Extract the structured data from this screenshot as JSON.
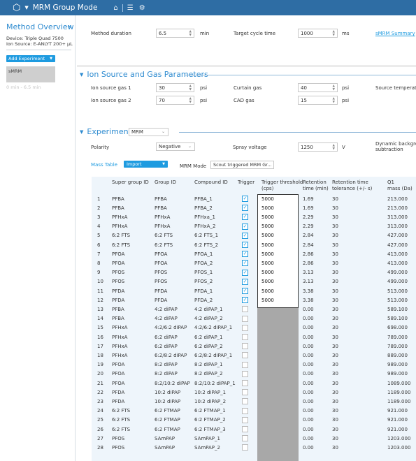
{
  "app": {
    "title": "MRM Group Mode"
  },
  "sidebar": {
    "title": "Method Overview",
    "collapse_glyph": "«",
    "device": "Device: Triple Quad 7500",
    "ion_source": "Ion Source: E-ANLYT 200+ µL",
    "add_experiment": "Add Experiment",
    "experiment_item": "sMRM",
    "time_range": "0 min - 6.5 min"
  },
  "method": {
    "duration_label": "Method duration",
    "duration_value": "6.5",
    "duration_unit": "min",
    "cycle_label": "Target cycle time",
    "cycle_value": "1000",
    "cycle_unit": "ms",
    "summary_link": "sMRM Summary"
  },
  "source_gas": {
    "title": "Ion Source and Gas Parameters",
    "gas1_label": "Ion source gas 1",
    "gas1_value": "30",
    "gas1_unit": "psi",
    "curtain_label": "Curtain gas",
    "curtain_value": "40",
    "curtain_unit": "psi",
    "temp_label": "Source temperature",
    "gas2_label": "Ion source gas 2",
    "gas2_value": "70",
    "gas2_unit": "psi",
    "cad_label": "CAD gas",
    "cad_value": "15",
    "cad_unit": "psi"
  },
  "experiment": {
    "title": "Experiment",
    "type_value": "MRM",
    "polarity_label": "Polarity",
    "polarity_value": "Negative",
    "spray_label": "Spray voltage",
    "spray_value": "1250",
    "spray_unit": "V",
    "dynamic_label_1": "Dynamic background",
    "dynamic_label_2": "subtraction",
    "mass_table_label": "Mass Table",
    "import_label": "Import",
    "mrm_mode_label": "MRM Mode",
    "mrm_mode_value": "Scout triggered MRM Gr..."
  },
  "table": {
    "headers": {
      "super": "Super group ID",
      "group": "Group ID",
      "compound": "Compound ID",
      "trigger": "Trigger",
      "threshold_1": "Trigger threshold",
      "threshold_2": "(cps)",
      "rt_1": "Retention",
      "rt_2": "time (min)",
      "tol_1": "Retention time",
      "tol_2": "tolerance (+/- s)",
      "q1_1": "Q1",
      "q1_2": "mass (Da)"
    },
    "rows": [
      {
        "n": "1",
        "super": "PFBA",
        "group": "PFBA",
        "compound": "PFBA_1",
        "trigger": true,
        "threshold": "5000",
        "rt": "1.69",
        "tol": "30",
        "q1": "213.000"
      },
      {
        "n": "2",
        "super": "PFBA",
        "group": "PFBA",
        "compound": "PFBA_2",
        "trigger": true,
        "threshold": "5000",
        "rt": "1.69",
        "tol": "30",
        "q1": "213.000"
      },
      {
        "n": "3",
        "super": "PFHxA",
        "group": "PFHxA",
        "compound": "PFHxa_1",
        "trigger": true,
        "threshold": "5000",
        "rt": "2.29",
        "tol": "30",
        "q1": "313.000"
      },
      {
        "n": "4",
        "super": "PFHxA",
        "group": "PFHxA",
        "compound": "PFHxA_2",
        "trigger": true,
        "threshold": "5000",
        "rt": "2.29",
        "tol": "30",
        "q1": "313.000"
      },
      {
        "n": "5",
        "super": "6:2 FTS",
        "group": "6:2 FTS",
        "compound": "6:2 FTS_1",
        "trigger": true,
        "threshold": "5000",
        "rt": "2.84",
        "tol": "30",
        "q1": "427.000"
      },
      {
        "n": "6",
        "super": "6:2 FTS",
        "group": "6:2 FTS",
        "compound": "6:2 FTS_2",
        "trigger": true,
        "threshold": "5000",
        "rt": "2.84",
        "tol": "30",
        "q1": "427.000"
      },
      {
        "n": "7",
        "super": "PFOA",
        "group": "PFOA",
        "compound": "PFOA_1",
        "trigger": true,
        "threshold": "5000",
        "rt": "2.86",
        "tol": "30",
        "q1": "413.000"
      },
      {
        "n": "8",
        "super": "PFOA",
        "group": "PFOA",
        "compound": "PFOA_2",
        "trigger": true,
        "threshold": "5000",
        "rt": "2.86",
        "tol": "30",
        "q1": "413.000"
      },
      {
        "n": "9",
        "super": "PFOS",
        "group": "PFOS",
        "compound": "PFOS_1",
        "trigger": true,
        "threshold": "5000",
        "rt": "3.13",
        "tol": "30",
        "q1": "499.000"
      },
      {
        "n": "10",
        "super": "PFOS",
        "group": "PFOS",
        "compound": "PFOS_2",
        "trigger": true,
        "threshold": "5000",
        "rt": "3.13",
        "tol": "30",
        "q1": "499.000"
      },
      {
        "n": "11",
        "super": "PFDA",
        "group": "PFDA",
        "compound": "PFDA_1",
        "trigger": true,
        "threshold": "5000",
        "rt": "3.38",
        "tol": "30",
        "q1": "513.000"
      },
      {
        "n": "12",
        "super": "PFDA",
        "group": "PFDA",
        "compound": "PFDA_2",
        "trigger": true,
        "threshold": "5000",
        "rt": "3.38",
        "tol": "30",
        "q1": "513.000"
      },
      {
        "n": "13",
        "super": "PFBA",
        "group": "4:2 diPAP",
        "compound": "4:2 diPAP_1",
        "trigger": false,
        "threshold": "",
        "rt": "0.00",
        "tol": "30",
        "q1": "589.100"
      },
      {
        "n": "14",
        "super": "PFBA",
        "group": "4:2 diPAP",
        "compound": "4:2 diPAP_2",
        "trigger": false,
        "threshold": "",
        "rt": "0.00",
        "tol": "30",
        "q1": "589.100"
      },
      {
        "n": "15",
        "super": "PFHxA",
        "group": "4:2/6:2 diPAP",
        "compound": "4:2/6:2 diPAP_1",
        "trigger": false,
        "threshold": "",
        "rt": "0.00",
        "tol": "30",
        "q1": "698.000"
      },
      {
        "n": "16",
        "super": "PFHxA",
        "group": "6:2 diPAP",
        "compound": "6:2 diPAP_1",
        "trigger": false,
        "threshold": "",
        "rt": "0.00",
        "tol": "30",
        "q1": "789.000"
      },
      {
        "n": "17",
        "super": "PFHxA",
        "group": "6:2 diPAP",
        "compound": "6:2 diPAP_2",
        "trigger": false,
        "threshold": "",
        "rt": "0.00",
        "tol": "30",
        "q1": "789.000"
      },
      {
        "n": "18",
        "super": "PFHxA",
        "group": "6:2/8:2 diPAP",
        "compound": "6:2/8:2 diPAP_1",
        "trigger": false,
        "threshold": "",
        "rt": "0.00",
        "tol": "30",
        "q1": "889.000"
      },
      {
        "n": "19",
        "super": "PFOA",
        "group": "8:2 diPAP",
        "compound": "8:2 diPAP_1",
        "trigger": false,
        "threshold": "",
        "rt": "0.00",
        "tol": "30",
        "q1": "989.000"
      },
      {
        "n": "20",
        "super": "PFOA",
        "group": "8:2 diPAP",
        "compound": "8:2 diPAP_2",
        "trigger": false,
        "threshold": "",
        "rt": "0.00",
        "tol": "30",
        "q1": "989.000"
      },
      {
        "n": "21",
        "super": "PFOA",
        "group": "8:2/10:2 diPAP",
        "compound": "8:2/10:2 diPAP_1",
        "trigger": false,
        "threshold": "",
        "rt": "0.00",
        "tol": "30",
        "q1": "1089.000"
      },
      {
        "n": "22",
        "super": "PFDA",
        "group": "10:2 diPAP",
        "compound": "10:2 diPAP_1",
        "trigger": false,
        "threshold": "",
        "rt": "0.00",
        "tol": "30",
        "q1": "1189.000"
      },
      {
        "n": "23",
        "super": "PFDA",
        "group": "10:2 diPAP",
        "compound": "10:2 diPAP_2",
        "trigger": false,
        "threshold": "",
        "rt": "0.00",
        "tol": "30",
        "q1": "1189.000"
      },
      {
        "n": "24",
        "super": "6:2 FTS",
        "group": "6:2 FTMAP",
        "compound": "6:2 FTMAP_1",
        "trigger": false,
        "threshold": "",
        "rt": "0.00",
        "tol": "30",
        "q1": "921.000"
      },
      {
        "n": "25",
        "super": "6:2 FTS",
        "group": "6:2 FTMAP",
        "compound": "6:2 FTMAP_2",
        "trigger": false,
        "threshold": "",
        "rt": "0.00",
        "tol": "30",
        "q1": "921.000"
      },
      {
        "n": "26",
        "super": "6:2 FTS",
        "group": "6:2 FTMAP",
        "compound": "6:2 FTMAP_3",
        "trigger": false,
        "threshold": "",
        "rt": "0.00",
        "tol": "30",
        "q1": "921.000"
      },
      {
        "n": "27",
        "super": "PFOS",
        "group": "SAmPAP",
        "compound": "SAmPAP_1",
        "trigger": false,
        "threshold": "",
        "rt": "0.00",
        "tol": "30",
        "q1": "1203.000"
      },
      {
        "n": "28",
        "super": "PFOS",
        "group": "SAmPAP",
        "compound": "SAmPAP_2",
        "trigger": false,
        "threshold": "",
        "rt": "0.00",
        "tol": "30",
        "q1": "1203.000"
      }
    ]
  },
  "colors": {
    "titlebar": "#2e6da4",
    "accent": "#1e9be0",
    "section_title": "#2e8bd0",
    "table_bg": "#eef5fb",
    "grey_cells": "#a8a8a8"
  },
  "icons": {
    "app": "hexagon-icon",
    "home": "home-icon",
    "list": "list-icon",
    "settings": "gear-icon",
    "collapse": "double-chevron-left-icon"
  }
}
